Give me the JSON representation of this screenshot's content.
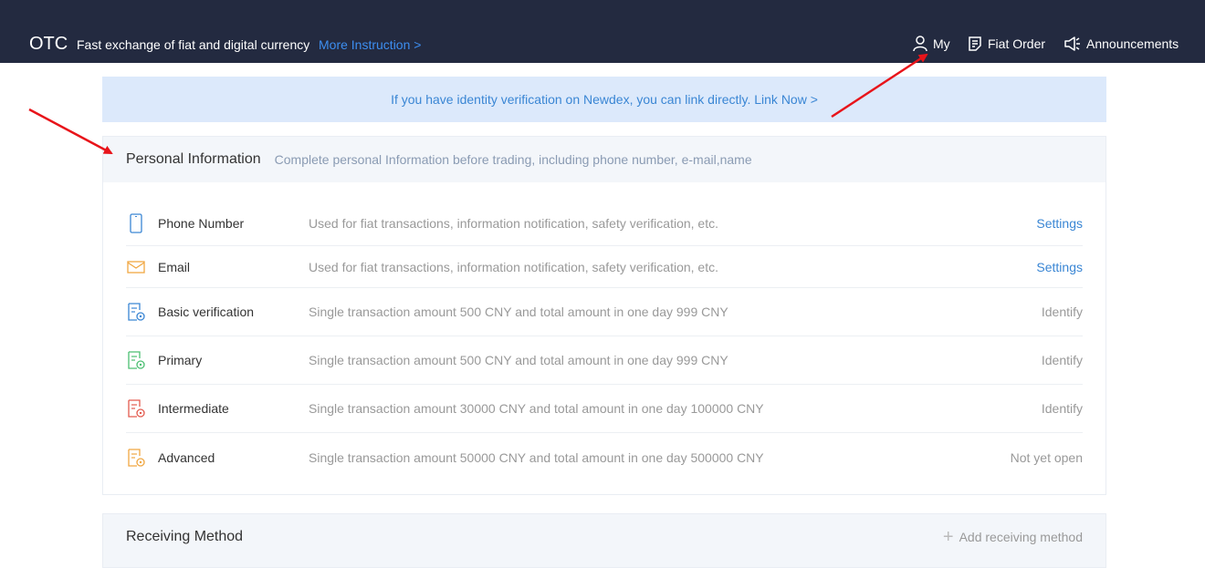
{
  "header": {
    "logo": "OTC",
    "tagline": "Fast exchange of fiat and digital currency",
    "more_link": "More Instruction >",
    "nav": [
      {
        "label": "My",
        "icon": "user-icon"
      },
      {
        "label": "Fiat Order",
        "icon": "order-icon"
      },
      {
        "label": "Announcements",
        "icon": "speaker-icon"
      }
    ]
  },
  "banner": {
    "text": "If you have identity verification on Newdex, you can link directly. Link Now >"
  },
  "personal": {
    "title": "Personal Information",
    "subtitle": "Complete personal Information before trading, including phone number, e-mail,name",
    "rows": [
      {
        "label": "Phone Number",
        "desc": "Used for fiat transactions, information notification, safety verification, etc.",
        "action": "Settings",
        "icon": "phone-icon",
        "color": "#3a86d4"
      },
      {
        "label": "Email",
        "desc": "Used for fiat transactions, information notification, safety verification, etc.",
        "action": "Settings",
        "icon": "mail-icon",
        "color": "#f0a742"
      },
      {
        "label": "Basic verification",
        "desc": "Single transaction amount 500 CNY and total amount in one day 999 CNY",
        "action": "Identify",
        "icon": "id-card-icon",
        "color": "#3a86d4"
      },
      {
        "label": "Primary",
        "desc": "Single transaction amount 500 CNY and total amount in one day 999 CNY",
        "action": "Identify",
        "icon": "id-card-icon",
        "color": "#4cbf72"
      },
      {
        "label": "Intermediate",
        "desc": "Single transaction amount 30000 CNY and total amount in one day 100000 CNY",
        "action": "Identify",
        "icon": "id-card-icon",
        "color": "#e35b4f"
      },
      {
        "label": "Advanced",
        "desc": "Single transaction amount 50000 CNY and total amount in one day 500000 CNY",
        "action": "Not yet open",
        "icon": "id-card-icon",
        "color": "#f0a742"
      }
    ]
  },
  "receiving": {
    "title": "Receiving Method",
    "add_label": "Add receiving method"
  },
  "colors": {
    "header_bg": "#232a40",
    "link": "#3a86d4",
    "annotation_arrow": "#e8141a"
  }
}
